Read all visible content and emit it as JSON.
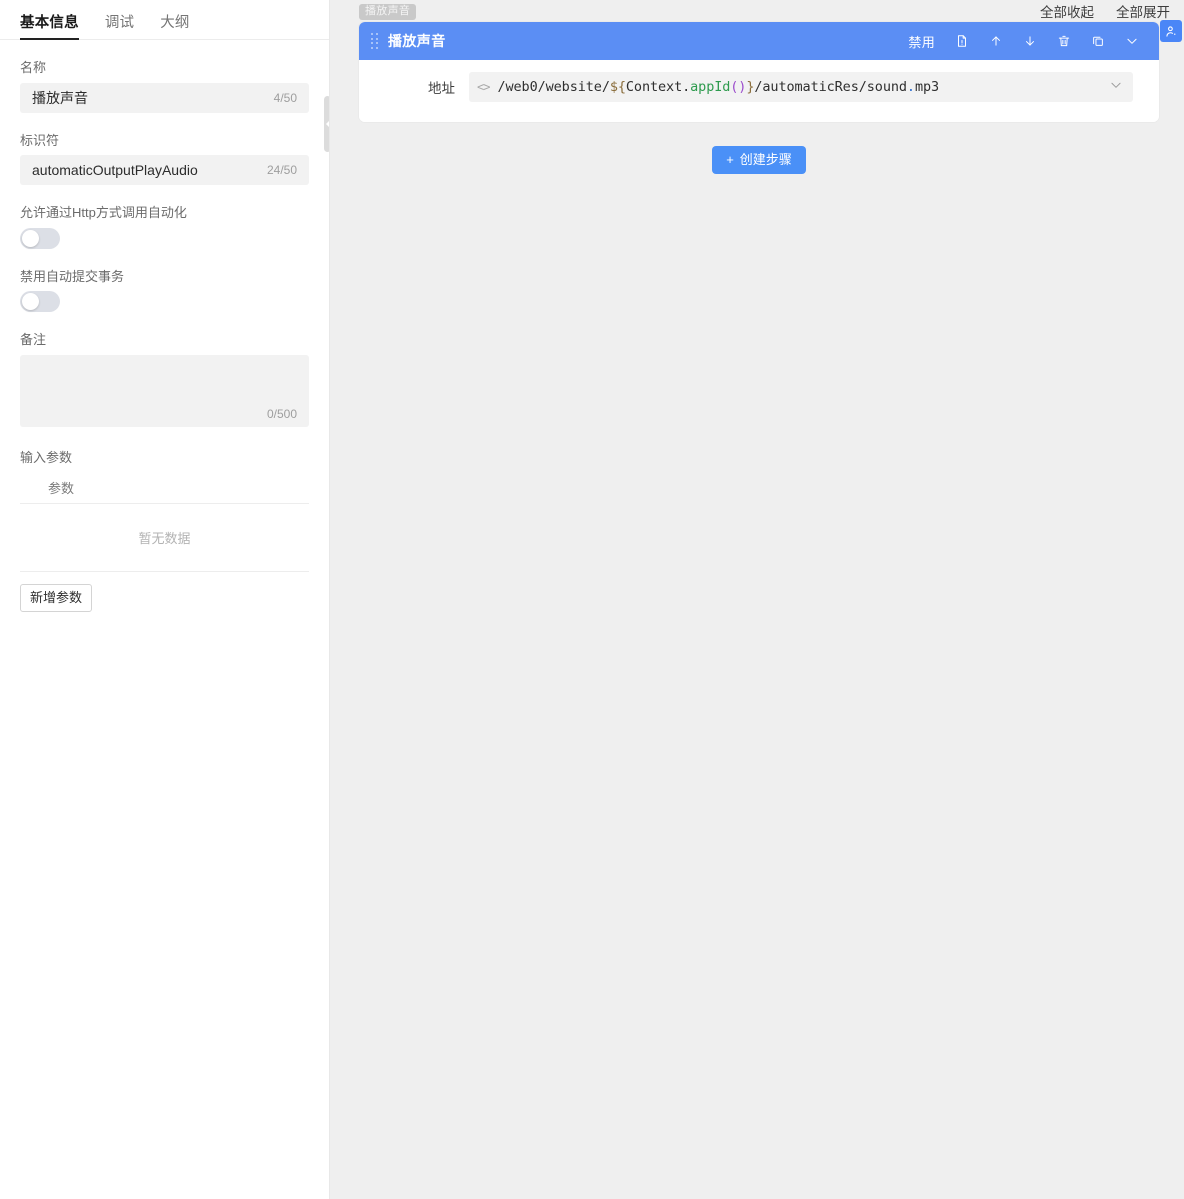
{
  "left": {
    "tabs": [
      {
        "label": "基本信息",
        "active": true
      },
      {
        "label": "调试",
        "active": false
      },
      {
        "label": "大纲",
        "active": false
      }
    ],
    "fields": {
      "name_label": "名称",
      "name_value": "播放声音",
      "name_counter": "4/50",
      "identifier_label": "标识符",
      "identifier_value": "automaticOutputPlayAudio",
      "identifier_counter": "24/50",
      "http_label": "允许通过Http方式调用自动化",
      "http_state": "off",
      "autocommit_label": "禁用自动提交事务",
      "autocommit_state": "off",
      "remark_label": "备注",
      "remark_value": "",
      "remark_placeholder": "",
      "remark_counter": "0/500"
    },
    "params": {
      "section_title": "输入参数",
      "columns": [
        "参数"
      ],
      "rows": [],
      "empty_text": "暂无数据",
      "add_button": "新增参数"
    }
  },
  "right": {
    "toolbar": {
      "collapse_all": "全部收起",
      "expand_all": "全部展开"
    },
    "user_icon": "user-icon",
    "breadcrumb_tag": "播放声音",
    "step": {
      "title": "播放声音",
      "drag_handle": "drag-handle-icon",
      "actions": [
        {
          "name": "disable-button",
          "label": "禁用",
          "type": "text"
        },
        {
          "name": "note-icon",
          "label": "",
          "type": "icon"
        },
        {
          "name": "move-up-icon",
          "label": "",
          "type": "icon"
        },
        {
          "name": "move-down-icon",
          "label": "",
          "type": "icon"
        },
        {
          "name": "delete-icon",
          "label": "",
          "type": "icon"
        },
        {
          "name": "copy-icon",
          "label": "",
          "type": "icon"
        },
        {
          "name": "chevron-down-icon",
          "label": "",
          "type": "icon"
        }
      ],
      "address_label": "地址",
      "address_icon": "code-icon",
      "address_value": "/web0/website/${Context.appId()}/automaticRes/sound.mp3",
      "address_tokens": [
        {
          "t": "/web0/website/",
          "c": "plain"
        },
        {
          "t": "${",
          "c": "tok-brace"
        },
        {
          "t": "Context.",
          "c": "plain"
        },
        {
          "t": "appId",
          "c": "tok-fn"
        },
        {
          "t": "()",
          "c": "tok-paren"
        },
        {
          "t": "}",
          "c": "tok-brace"
        },
        {
          "t": "/automaticRes/sound",
          "c": "plain"
        },
        {
          "t": ".",
          "c": "tok-dot"
        },
        {
          "t": "mp3",
          "c": "plain"
        }
      ]
    },
    "create_step_button": "创建步骤",
    "create_step_plus": "+"
  },
  "colors": {
    "accent": "#4a90f7",
    "step_header": "#5b8ef4",
    "canvas_bg": "#efefef",
    "input_bg": "#f2f2f2",
    "muted_text": "#9e9e9e"
  }
}
